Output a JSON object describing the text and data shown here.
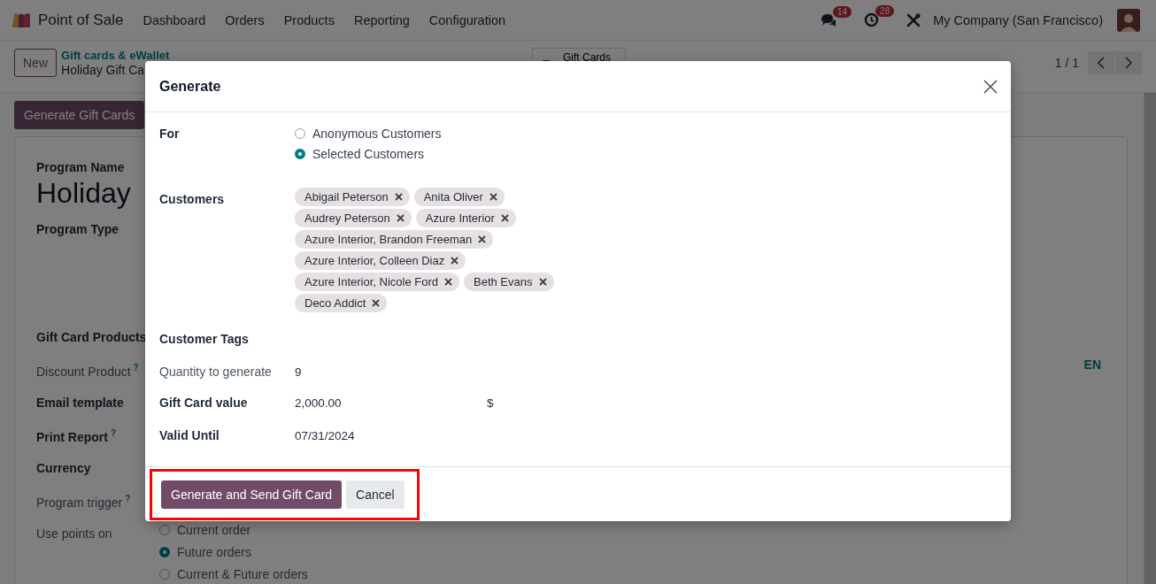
{
  "navbar": {
    "app_name": "Point of Sale",
    "menu": [
      "Dashboard",
      "Orders",
      "Products",
      "Reporting",
      "Configuration"
    ],
    "messages_badge": "14",
    "activities_badge": "28",
    "company": "My Company (San Francisco)"
  },
  "control_panel": {
    "new_button": "New",
    "breadcrumb_parent": "Gift cards & eWallet",
    "breadcrumb_current": "Holiday Gift Ca",
    "smart_button": "Gift Cards",
    "pager": "1 / 1"
  },
  "action_button": "Generate Gift Cards",
  "form": {
    "name_label": "Program Name",
    "name_value": "Holiday",
    "type_label": "Program Type",
    "fields": [
      {
        "label": "Gift Card Products",
        "strong": true
      },
      {
        "label": "Discount Product",
        "strong": false,
        "help": "?"
      },
      {
        "label": "Email template",
        "strong": true
      },
      {
        "label": "Print Report",
        "strong": true,
        "help": "?"
      },
      {
        "label": "Currency",
        "strong": true
      },
      {
        "label": "Program trigger",
        "strong": false,
        "help": "?"
      },
      {
        "label": "Use points on",
        "strong": false
      }
    ],
    "use_points_options": [
      {
        "label": "Current order",
        "selected": false
      },
      {
        "label": "Future orders",
        "selected": true
      },
      {
        "label": "Current & Future orders",
        "selected": false
      }
    ],
    "language_badge": "EN"
  },
  "dialog": {
    "title": "Generate",
    "for": {
      "label": "For",
      "options": [
        {
          "label": "Anonymous Customers",
          "selected": false
        },
        {
          "label": "Selected Customers",
          "selected": true
        }
      ]
    },
    "customers": {
      "label": "Customers",
      "tags": [
        "Abigail Peterson",
        "Anita Oliver",
        "Audrey Peterson",
        "Azure Interior",
        "Azure Interior, Brandon Freeman",
        "Azure Interior, Colleen Diaz",
        "Azure Interior, Nicole Ford",
        "Beth Evans",
        "Deco Addict"
      ]
    },
    "customer_tags": {
      "label": "Customer Tags"
    },
    "quantity": {
      "label": "Quantity to generate",
      "value": "9"
    },
    "value": {
      "label": "Gift Card value",
      "amount": "2,000.00",
      "currency": "$"
    },
    "valid_until": {
      "label": "Valid Until",
      "value": "07/31/2024"
    },
    "buttons": [
      {
        "label": "Generate and Send Gift Card",
        "kind": "primary"
      },
      {
        "label": "Cancel",
        "kind": "secondary"
      }
    ],
    "highlight": true
  }
}
